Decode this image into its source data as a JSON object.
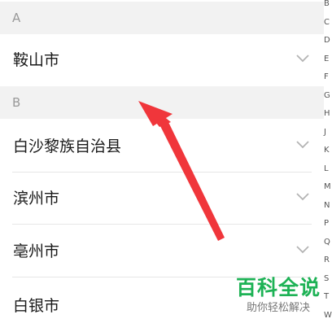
{
  "sections": [
    {
      "header": "A",
      "cities": [
        "鞍山市"
      ]
    },
    {
      "header": "B",
      "cities": [
        "白沙黎族自治县",
        "滨州市",
        "亳州市",
        "白银市"
      ]
    }
  ],
  "index_letters": [
    "B",
    "C",
    "D",
    "E",
    "F",
    "G",
    "H",
    "J",
    "K",
    "L",
    "M",
    "N",
    "P",
    "Q",
    "R",
    "S",
    "T",
    "W"
  ],
  "watermark": {
    "title": "百科全说",
    "subtitle": "助你轻松解决"
  },
  "colors": {
    "section_bg": "#f2f2f2",
    "annotation_arrow": "#f0363b",
    "watermark_green": "#1db255"
  },
  "icons": {
    "row_chevron": "chevron-down-icon"
  }
}
